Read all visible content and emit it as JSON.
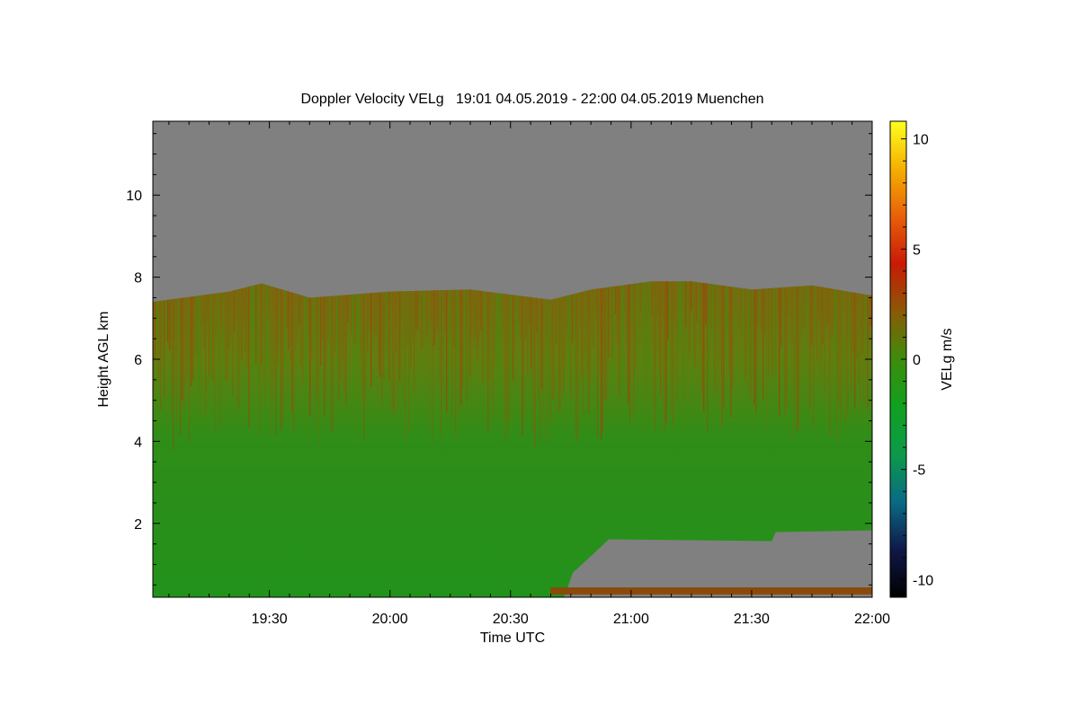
{
  "chart_data": {
    "type": "heatmap",
    "title": "Doppler Velocity VELg   19:01 04.05.2019 - 22:00 04.05.2019 Muenchen",
    "xlabel": "Time UTC",
    "ylabel": "Height AGL km",
    "colorbar_label": "VELg m/s",
    "x_range": [
      "19:01",
      "22:00"
    ],
    "y_range": [
      0.2,
      11.8
    ],
    "color_range": [
      -10.8,
      10.8
    ],
    "x_ticks": [
      "19:30",
      "20:00",
      "20:30",
      "21:00",
      "21:30",
      "22:00"
    ],
    "y_ticks": [
      2,
      4,
      6,
      8,
      10
    ],
    "colorbar_ticks": [
      10,
      5,
      0,
      -5,
      -10
    ],
    "colorbar_tick_labels": [
      "10",
      "5",
      "0",
      "-5",
      "-10"
    ],
    "background_color": "#808080",
    "colormap": [
      "#000000",
      "#101848",
      "#0a6a84",
      "#0c9a4a",
      "#10a020",
      "#3e8c0c",
      "#8a5a06",
      "#c81a06",
      "#e8600a",
      "#f4b000",
      "#ffff20"
    ],
    "features": {
      "cloud_top_km": [
        {
          "time": "19:01",
          "top": 7.4
        },
        {
          "time": "19:20",
          "top": 7.65
        },
        {
          "time": "19:28",
          "top": 7.85
        },
        {
          "time": "19:40",
          "top": 7.5
        },
        {
          "time": "20:00",
          "top": 7.65
        },
        {
          "time": "20:20",
          "top": 7.7
        },
        {
          "time": "20:40",
          "top": 7.45
        },
        {
          "time": "20:50",
          "top": 7.7
        },
        {
          "time": "21:05",
          "top": 7.9
        },
        {
          "time": "21:15",
          "top": 7.9
        },
        {
          "time": "21:30",
          "top": 7.7
        },
        {
          "time": "21:45",
          "top": 7.8
        },
        {
          "time": "22:00",
          "top": 7.55
        }
      ],
      "clear_lower_region": {
        "start_time": "20:50",
        "end_time": "22:00",
        "top_km": 1.7,
        "bottom_km": 0.2
      },
      "dominant_velocity_m_s": -1.5
    }
  }
}
